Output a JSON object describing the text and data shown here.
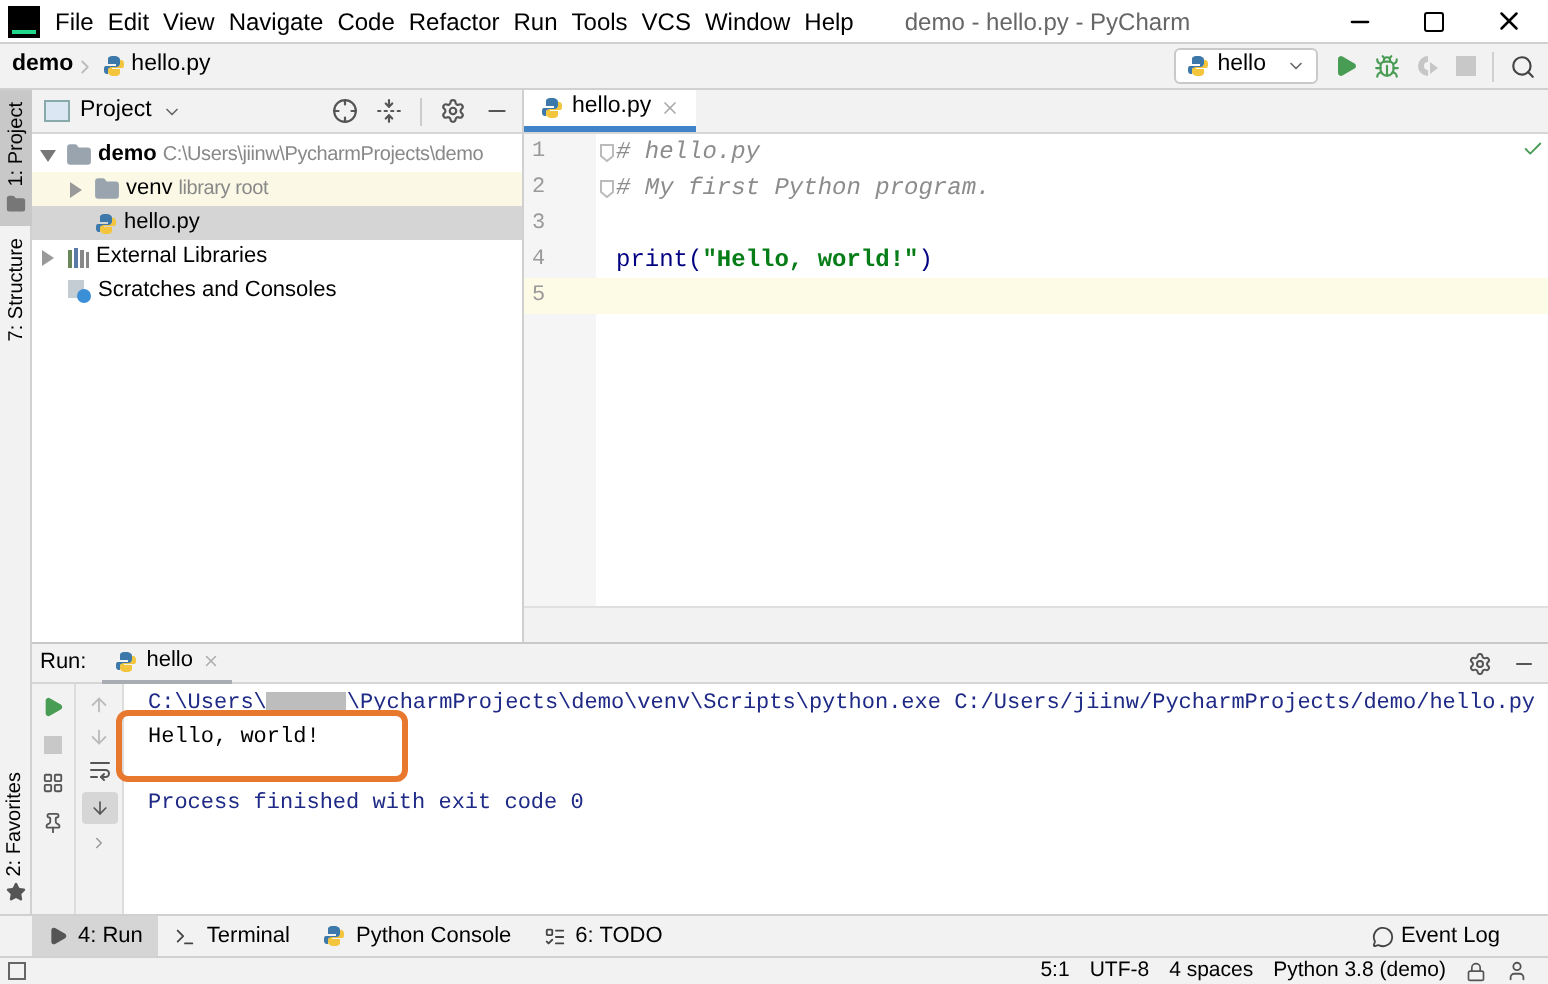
{
  "window": {
    "title": "demo - hello.py - PyCharm"
  },
  "menu": [
    "File",
    "Edit",
    "View",
    "Navigate",
    "Code",
    "Refactor",
    "Run",
    "Tools",
    "VCS",
    "Window",
    "Help"
  ],
  "breadcrumb": [
    "demo",
    "hello.py"
  ],
  "run_config": {
    "label": "hello"
  },
  "side_tabs": [
    {
      "label": "1: Project",
      "selected": true
    },
    {
      "label": "7: Structure",
      "selected": false
    }
  ],
  "favorites": {
    "label": "2: Favorites"
  },
  "project_panel": {
    "title": "Project",
    "tree": [
      {
        "kind": "folder",
        "name": "demo",
        "note": "C:\\Users\\jiinw\\PycharmProjects\\demo",
        "expanded": true,
        "selected": false,
        "children": [
          {
            "kind": "folder",
            "name": "venv",
            "note": "library root",
            "expanded": false,
            "selected": false
          },
          {
            "kind": "python",
            "name": "hello.py",
            "selected": true
          }
        ]
      },
      {
        "kind": "libraries",
        "name": "External Libraries",
        "expanded": false,
        "selected": false
      },
      {
        "kind": "scratches",
        "name": "Scratches and Consoles",
        "selected": false
      }
    ]
  },
  "editor": {
    "tabs": [
      {
        "label": "hello.py",
        "selected": true
      }
    ],
    "lines": [
      {
        "number": "1",
        "current": false,
        "fold": true,
        "parts": [
          {
            "kind": "comment",
            "text": "# hello.py"
          }
        ]
      },
      {
        "number": "2",
        "current": false,
        "fold": true,
        "parts": [
          {
            "kind": "comment",
            "text": "# My first Python program."
          }
        ]
      },
      {
        "number": "3",
        "current": false,
        "fold": false
      },
      {
        "number": "4",
        "current": false,
        "fold": false,
        "parts": [
          {
            "kind": "plain",
            "text": "print("
          },
          {
            "kind": "string",
            "text": "\"Hello, world!\""
          },
          {
            "kind": "plain",
            "text": ")"
          }
        ]
      },
      {
        "number": "5",
        "current": true,
        "fold": false
      }
    ]
  },
  "run_panel": {
    "label": "Run:",
    "tabs": [
      {
        "label": "hello",
        "selected": true
      }
    ],
    "console": [
      {
        "kind": "command",
        "before": "C:\\Users\\",
        "after": "\\PycharmProjects\\demo\\venv\\Scripts\\python.exe C:/Users/jiinw/PycharmProjects/demo/hello.py"
      },
      {
        "kind": "output",
        "text": "Hello, world!",
        "highlighted": true
      },
      {
        "kind": "info",
        "text": "Process finished with exit code 0"
      }
    ]
  },
  "tool_windows": [
    {
      "kind": "run",
      "label": "4: Run",
      "selected": true
    },
    {
      "kind": "terminal",
      "label": "Terminal",
      "selected": false
    },
    {
      "kind": "python",
      "label": "Python Console",
      "selected": false
    },
    {
      "kind": "todo",
      "label": "6: TODO",
      "selected": false
    }
  ],
  "event_log": {
    "label": "Event Log"
  },
  "status_bar": [
    "5:1",
    "UTF-8",
    "4 spaces",
    "Python 3.8 (demo)"
  ]
}
